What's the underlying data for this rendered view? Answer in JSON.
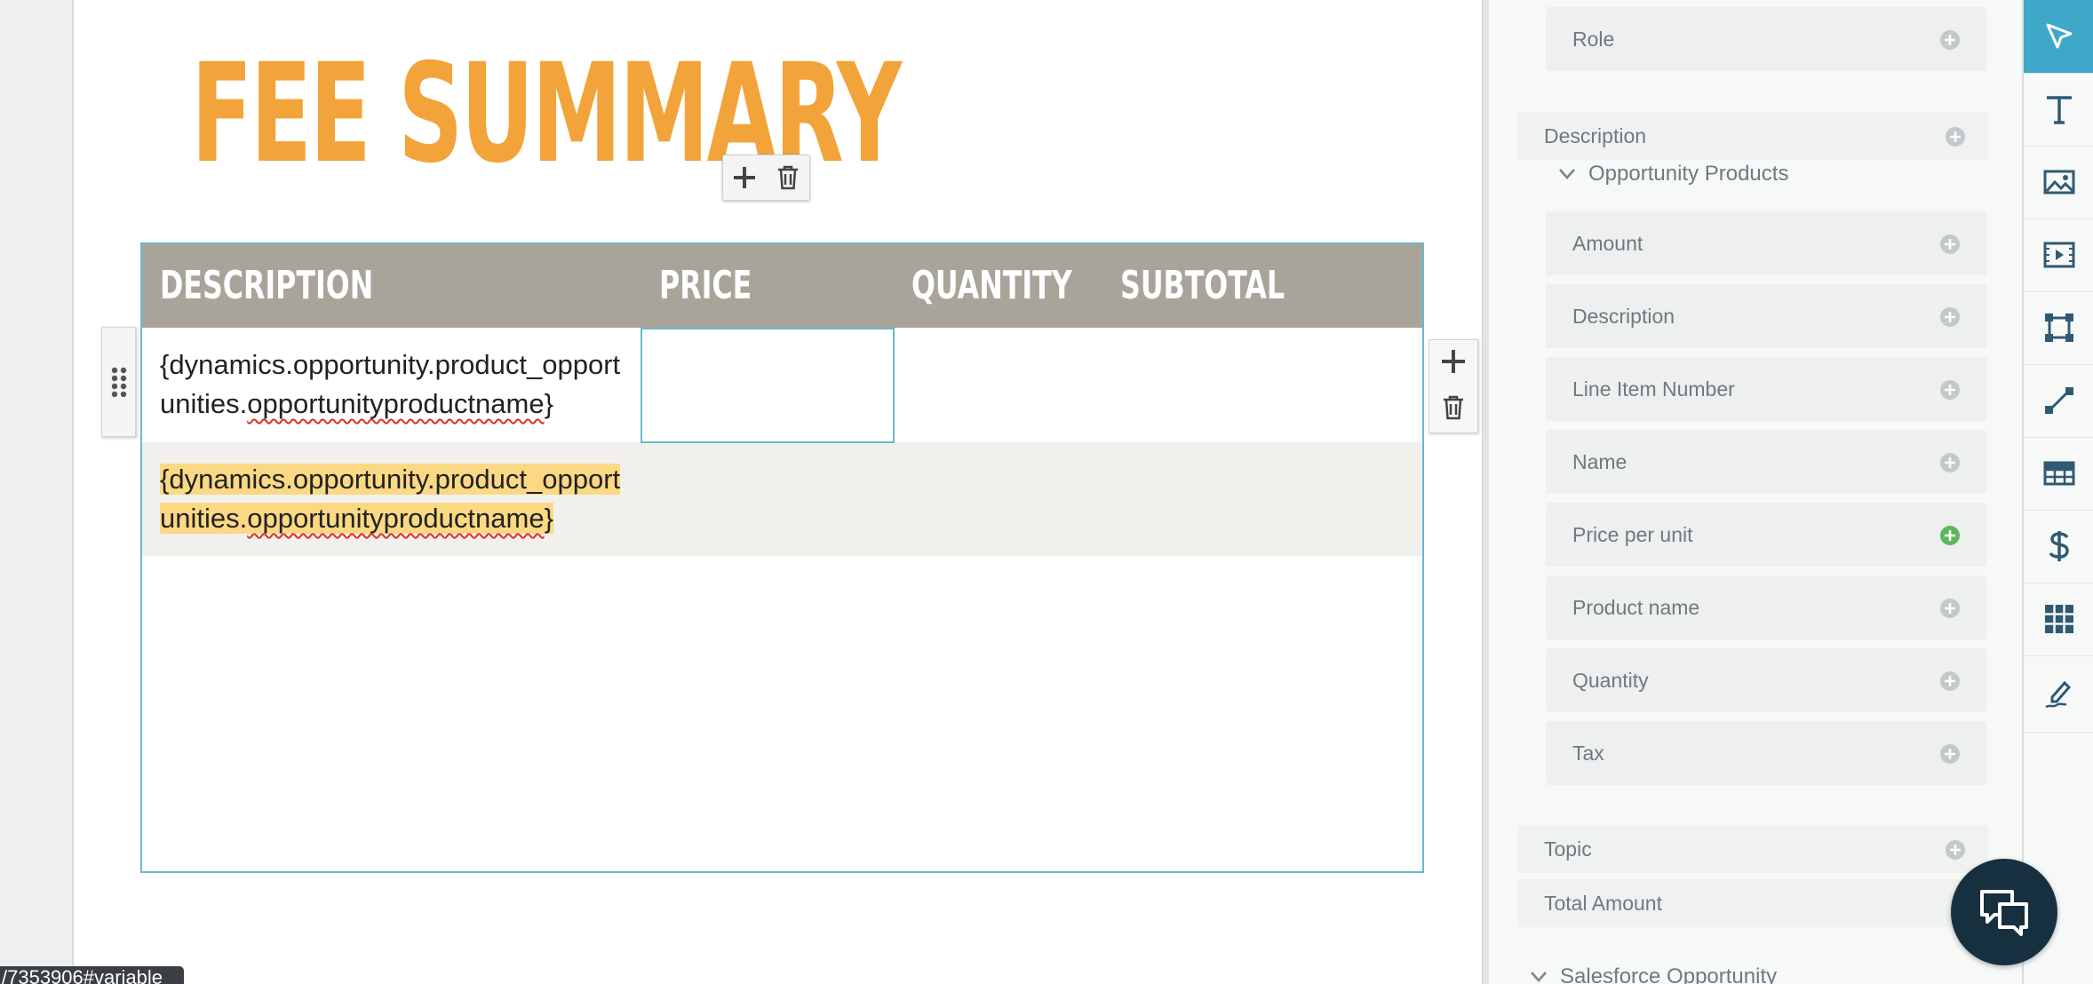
{
  "document": {
    "title": "FEE SUMMARY",
    "table": {
      "headers": [
        "DESCRIPTION",
        "PRICE",
        "QUANTITY",
        "SUBTOTAL"
      ],
      "rows": [
        {
          "description_line1": "{dynamics.opportunity.product_opport",
          "description_line2_prefix": "unities.",
          "description_line2_word": "opportunityproductname",
          "description_line2_suffix": "}"
        },
        {
          "description_line1": "{dynamics.opportunity.product_opport",
          "description_line2_prefix": "unities.",
          "description_line2_word": "opportunityproductname",
          "description_line2_suffix": "}"
        }
      ]
    }
  },
  "status_url": "/7353906#variable",
  "panel": {
    "role_label": "Role",
    "description_group_label": "Description",
    "opportunity_products_label": "Opportunity Products",
    "fields": [
      "Amount",
      "Description",
      "Line Item Number",
      "Name",
      "Price per unit",
      "Product name",
      "Quantity",
      "Tax"
    ],
    "topic_label": "Topic",
    "total_amount_label": "Total Amount",
    "salesforce_label": "Salesforce Opportunity"
  },
  "colors": {
    "title_orange": "#f2a43a",
    "header_gray": "#a9a49a",
    "selection_blue": "#6bb8cf",
    "highlight_yellow": "#fbd984",
    "active_tool": "#3fa8c8",
    "add_green": "#5cb85c"
  },
  "icons": {
    "toolbar": [
      "plus-icon",
      "trash-icon"
    ],
    "tools": [
      "cursor-icon",
      "text-icon",
      "image-icon",
      "video-icon",
      "shape-icon",
      "line-icon",
      "table-icon",
      "dollar-icon",
      "grid-icon",
      "signature-icon"
    ],
    "chat": "chat-icon"
  }
}
